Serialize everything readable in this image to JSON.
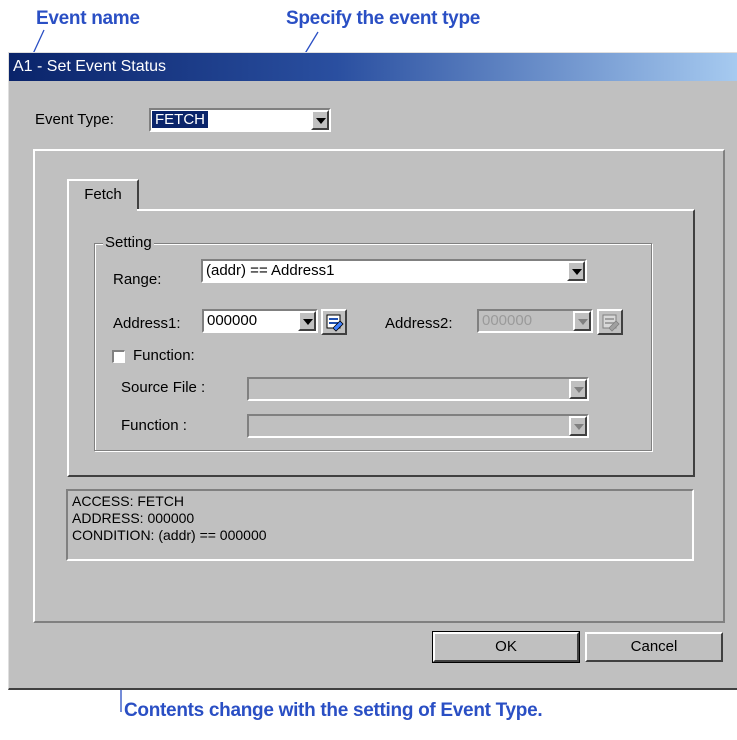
{
  "annotations": {
    "event_name": "Event name",
    "event_type": "Specify the event type",
    "contents": "Contents change with the setting of Event Type."
  },
  "window": {
    "title": "A1 - Set Event Status"
  },
  "event_type": {
    "label": "Event Type:",
    "value": "FETCH"
  },
  "tabs": [
    {
      "label": "Fetch"
    }
  ],
  "setting": {
    "legend": "Setting",
    "range_label": "Range:",
    "range_value": "(addr) == Address1",
    "address1_label": "Address1:",
    "address1_value": "000000",
    "address2_label": "Address2:",
    "address2_value": "000000",
    "function_checkbox_label": "Function:",
    "function_checked": false,
    "source_file_label": "Source File :",
    "source_file_value": "",
    "function_label": "Function :",
    "function_value": ""
  },
  "summary": {
    "lines": [
      "ACCESS: FETCH",
      "ADDRESS: 000000",
      "CONDITION: (addr) == 000000"
    ]
  },
  "buttons": {
    "ok": "OK",
    "cancel": "Cancel"
  },
  "colors": {
    "annotation": "#2a4fc4",
    "titlebar_start": "#0a246a",
    "titlebar_end": "#a6caf0",
    "dialog_face": "#c0c0c0",
    "selection": "#0a246a"
  }
}
